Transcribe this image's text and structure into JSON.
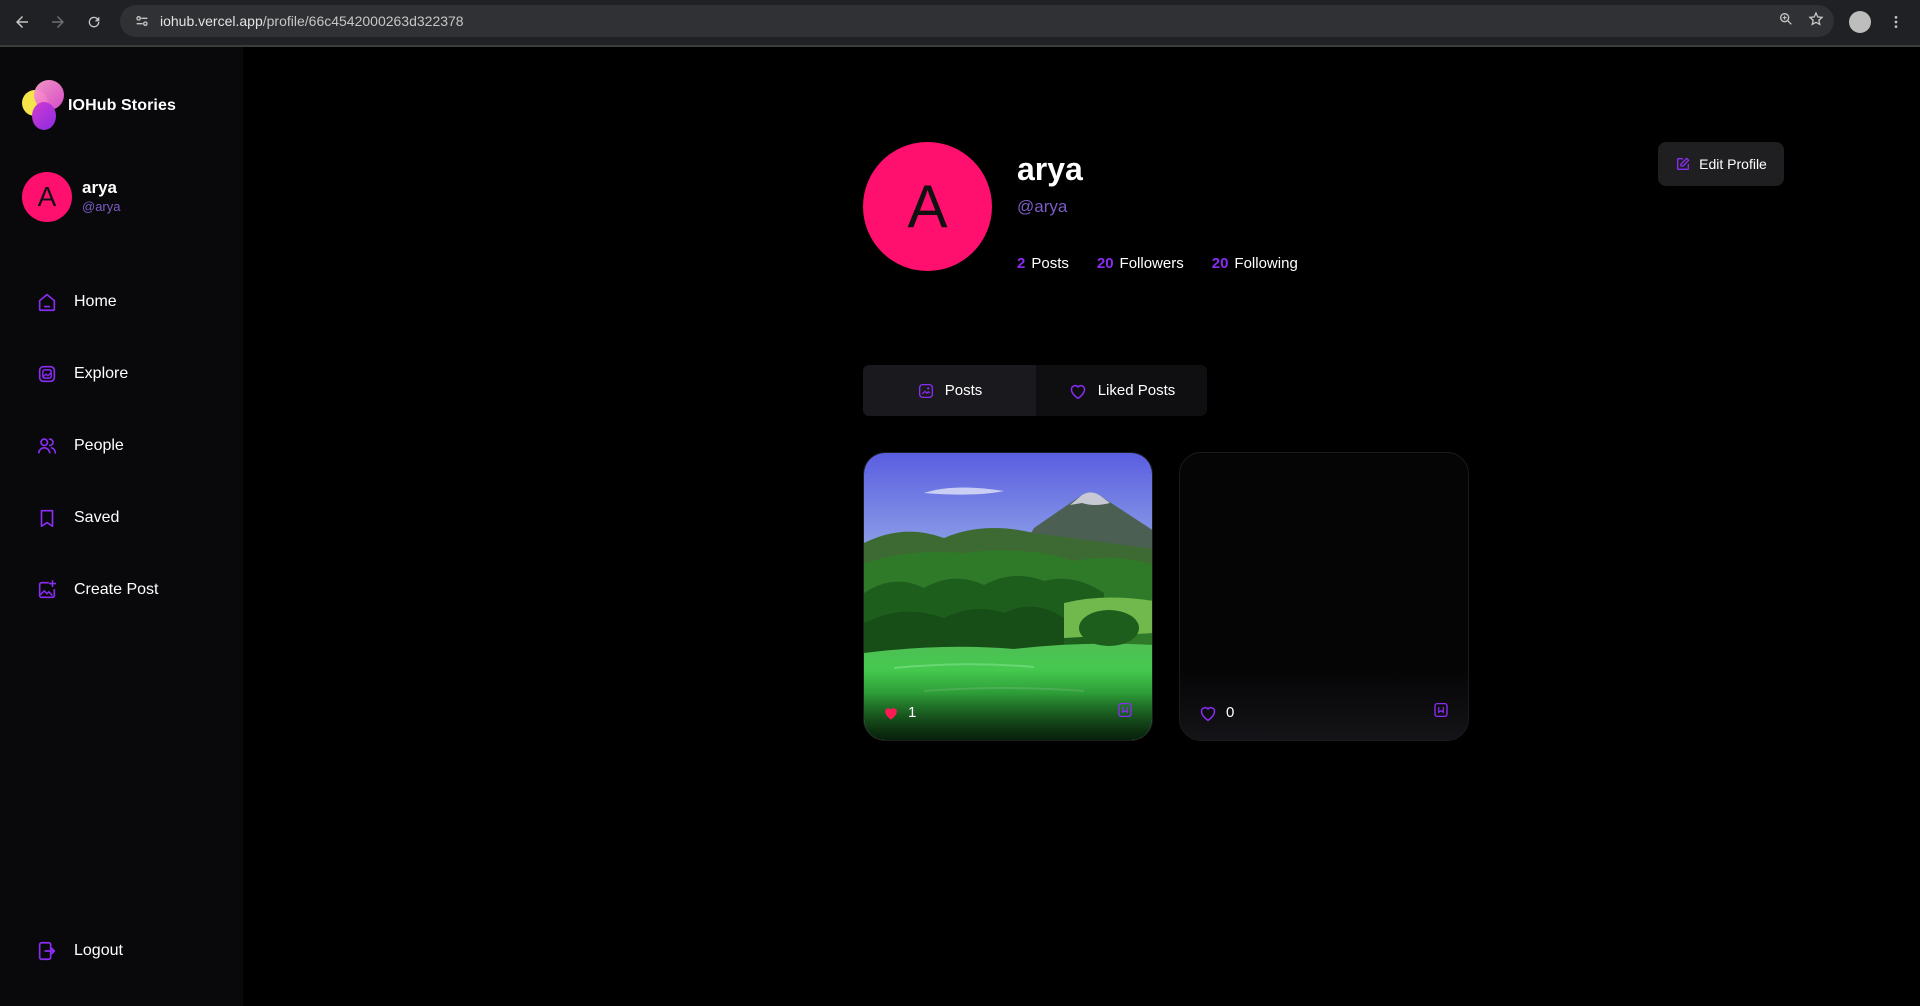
{
  "browser": {
    "url_host": "iohub.vercel.app",
    "url_path": "/profile/66c4542000263d322378"
  },
  "sidebar": {
    "brand": "IOHub Stories",
    "user": {
      "initial": "A",
      "name": "arya",
      "handle": "@arya"
    },
    "items": [
      {
        "label": "Home",
        "icon": "home-icon"
      },
      {
        "label": "Explore",
        "icon": "explore-icon"
      },
      {
        "label": "People",
        "icon": "people-icon"
      },
      {
        "label": "Saved",
        "icon": "bookmark-icon"
      },
      {
        "label": "Create Post",
        "icon": "create-post-icon"
      }
    ],
    "logout_label": "Logout"
  },
  "profile": {
    "initial": "A",
    "name": "arya",
    "handle": "@arya",
    "stats": [
      {
        "value": "2",
        "label": "Posts"
      },
      {
        "value": "20",
        "label": "Followers"
      },
      {
        "value": "20",
        "label": "Following"
      }
    ],
    "edit_label": "Edit Profile"
  },
  "tabs": [
    {
      "label": "Posts",
      "icon": "posts-icon",
      "active": true
    },
    {
      "label": "Liked Posts",
      "icon": "heart-icon",
      "active": false
    }
  ],
  "posts": [
    {
      "likes": "1",
      "liked": true,
      "image": "mountain-lake-landscape"
    },
    {
      "likes": "0",
      "liked": false,
      "image": ""
    }
  ],
  "colors": {
    "accent": "#8b2cf5",
    "avatar": "#ff0f6e",
    "liked": "#ff1a55"
  }
}
